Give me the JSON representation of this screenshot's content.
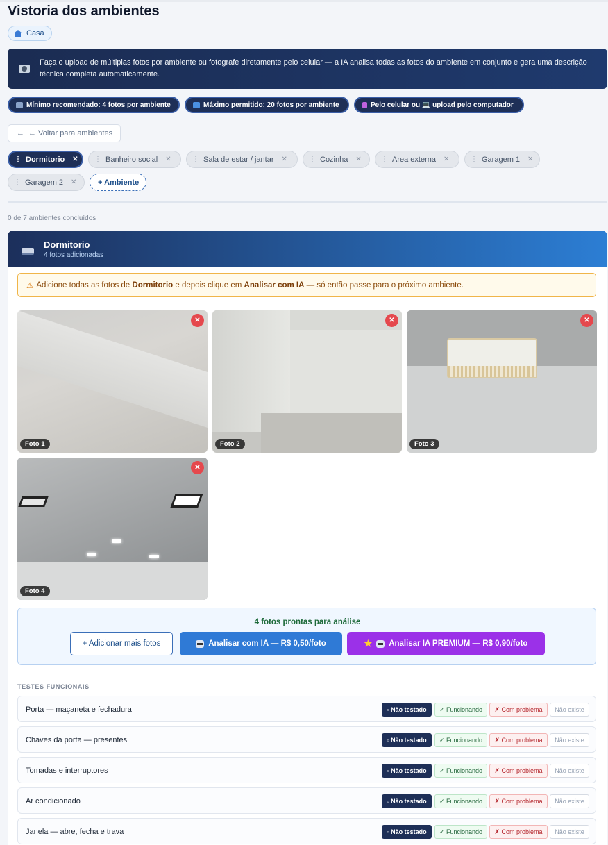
{
  "page": {
    "title": "Vistoria dos ambientes",
    "breadcrumb": "Casa"
  },
  "info_banner": "Faça o upload de múltiplas fotos por ambiente ou fotografe diretamente pelo celular — a IA analisa todas as fotos do ambiente em conjunto e gera uma descrição técnica completa automaticamente.",
  "pills": [
    {
      "label": "Mínimo recomendado: 4 fotos por ambiente",
      "icon": "tv-icon",
      "icon_color": "#8aa2c8"
    },
    {
      "label": "Máximo permitido: 20 fotos por ambiente",
      "icon": "grid-icon",
      "icon_color": "#4a90e2"
    },
    {
      "label": "Pelo celular ou 💻 upload pelo computador",
      "icon": "phone-icon",
      "icon_color": "#c062e0"
    }
  ],
  "back_button": "← Voltar para ambientes",
  "rooms": [
    {
      "label": "Dormitorio",
      "active": true
    },
    {
      "label": "Banheiro social"
    },
    {
      "label": "Sala de estar / jantar"
    },
    {
      "label": "Cozinha"
    },
    {
      "label": "Area externa"
    },
    {
      "label": "Garagem 1"
    },
    {
      "label": "Garagem 2"
    }
  ],
  "add_room": "+ Ambiente",
  "progress": "0 de 7 ambientes concluídos",
  "current_room": {
    "name": "Dormitorio",
    "subtitle": "4 fotos adicionadas"
  },
  "warning": {
    "a": "Adicione todas as fotos de ",
    "room": "Dormitorio",
    "b": " e depois clique em ",
    "action": "Analisar com IA",
    "c": " — só então passe para o próximo ambiente."
  },
  "photos": [
    {
      "label": "Foto 1"
    },
    {
      "label": "Foto 2"
    },
    {
      "label": "Foto 3"
    },
    {
      "label": "Foto 4"
    }
  ],
  "ready": {
    "title": "4 fotos prontas para análise",
    "add_more": "+ Adicionar mais fotos",
    "analyze": "Analisar com IA — R$ 0,50/foto",
    "premium": "Analisar IA PREMIUM — R$ 0,90/foto"
  },
  "tests": {
    "heading": "TESTES FUNCIONAIS",
    "options": [
      "▫ Não testado",
      "✓ Funcionando",
      "✗ Com problema",
      "Não existe"
    ],
    "items": [
      "Porta — maçaneta e fechadura",
      "Chaves da porta — presentes",
      "Tomadas e interruptores",
      "Ar condicionado",
      "Janela — abre, fecha e trava"
    ]
  },
  "colors": {
    "navy": "#1e2f57",
    "primary": "#2f7ad6",
    "premium": "#9b31e8",
    "danger": "#e5484d",
    "warning_border": "#f0b549"
  }
}
